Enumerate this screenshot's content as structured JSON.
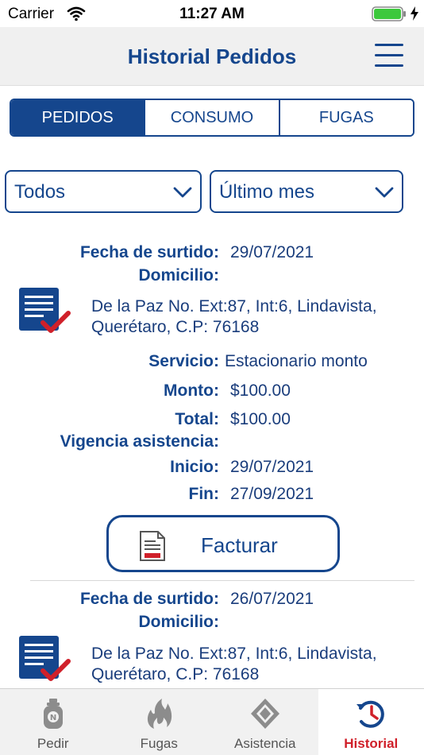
{
  "status_bar": {
    "carrier": "Carrier",
    "time": "11:27 AM"
  },
  "nav": {
    "title": "Historial Pedidos"
  },
  "segments": [
    {
      "label": "PEDIDOS",
      "active": true
    },
    {
      "label": "CONSUMO",
      "active": false
    },
    {
      "label": "FUGAS",
      "active": false
    }
  ],
  "filters": {
    "type": "Todos",
    "period": "Último mes"
  },
  "labels": {
    "fecha": "Fecha de surtido:",
    "domicilio": "Domicilio:",
    "servicio": "Servicio:",
    "monto": "Monto:",
    "total": "Total:",
    "vigencia": "Vigencia asistencia:",
    "inicio": "Inicio:",
    "fin": "Fin:",
    "facturar": "Facturar"
  },
  "orders": [
    {
      "fecha": "29/07/2021",
      "address_line1": "De la Paz No. Ext:87, Int:6, Lindavista,",
      "address_line2": "Querétaro, C.P: 76168",
      "servicio": "Estacionario monto",
      "monto": "$100.00",
      "total": "$100.00",
      "inicio": "29/07/2021",
      "fin": "27/09/2021"
    },
    {
      "fecha": "26/07/2021",
      "address_line1": "De la Paz No. Ext:87, Int:6, Lindavista,",
      "address_line2": "Querétaro, C.P: 76168"
    }
  ],
  "tabs": [
    {
      "label": "Pedir",
      "icon": "gas-tank-icon",
      "active": false
    },
    {
      "label": "Fugas",
      "icon": "flame-icon",
      "active": false
    },
    {
      "label": "Asistencia",
      "icon": "diamond-icon",
      "active": false
    },
    {
      "label": "Historial",
      "icon": "history-clock-icon",
      "active": true
    }
  ],
  "colors": {
    "primary": "#15468d",
    "accent": "#d0202a"
  }
}
